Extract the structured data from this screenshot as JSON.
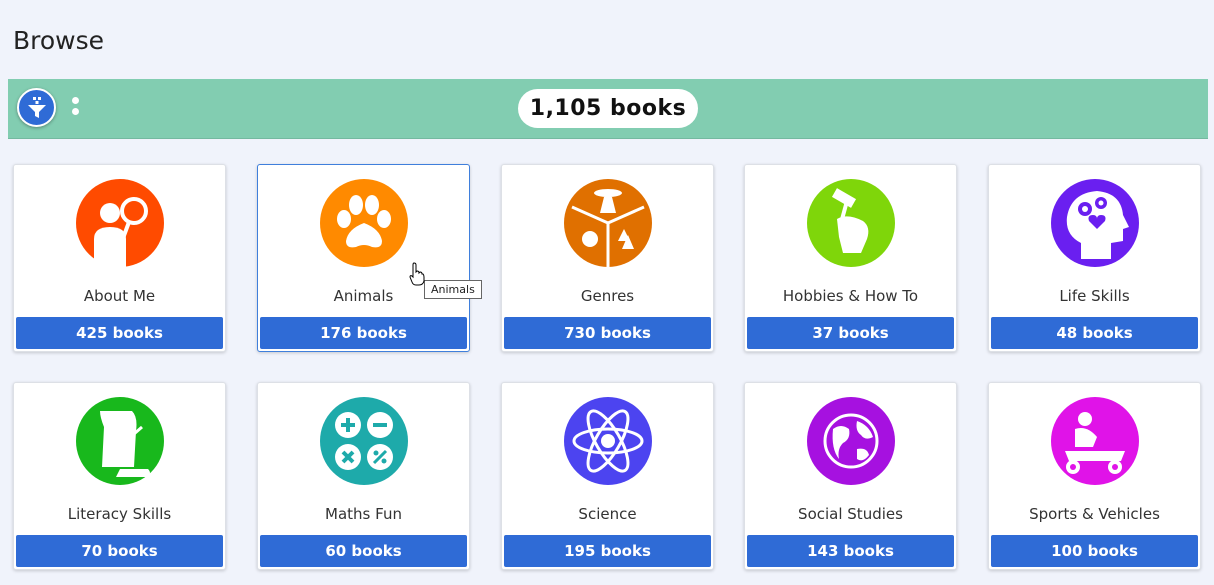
{
  "page": {
    "title": "Browse"
  },
  "toolbar": {
    "count_label": "1,105 books"
  },
  "categories": [
    {
      "name": "About Me",
      "books": "425 books",
      "color": "#ff4b00"
    },
    {
      "name": "Animals",
      "books": "176 books",
      "color": "#ff8a00"
    },
    {
      "name": "Genres",
      "books": "730 books",
      "color": "#e07000"
    },
    {
      "name": "Hobbies & How To",
      "books": "37 books",
      "color": "#7fd60a"
    },
    {
      "name": "Life Skills",
      "books": "48 books",
      "color": "#6a1ff0"
    },
    {
      "name": "Literacy Skills",
      "books": "70 books",
      "color": "#18b81c"
    },
    {
      "name": "Maths Fun",
      "books": "60 books",
      "color": "#1eaaaa"
    },
    {
      "name": "Science",
      "books": "195 books",
      "color": "#4c44f0"
    },
    {
      "name": "Social Studies",
      "books": "143 books",
      "color": "#a611e0"
    },
    {
      "name": "Sports & Vehicles",
      "books": "100 books",
      "color": "#e013e8"
    }
  ],
  "tooltip": {
    "text": "Animals"
  }
}
